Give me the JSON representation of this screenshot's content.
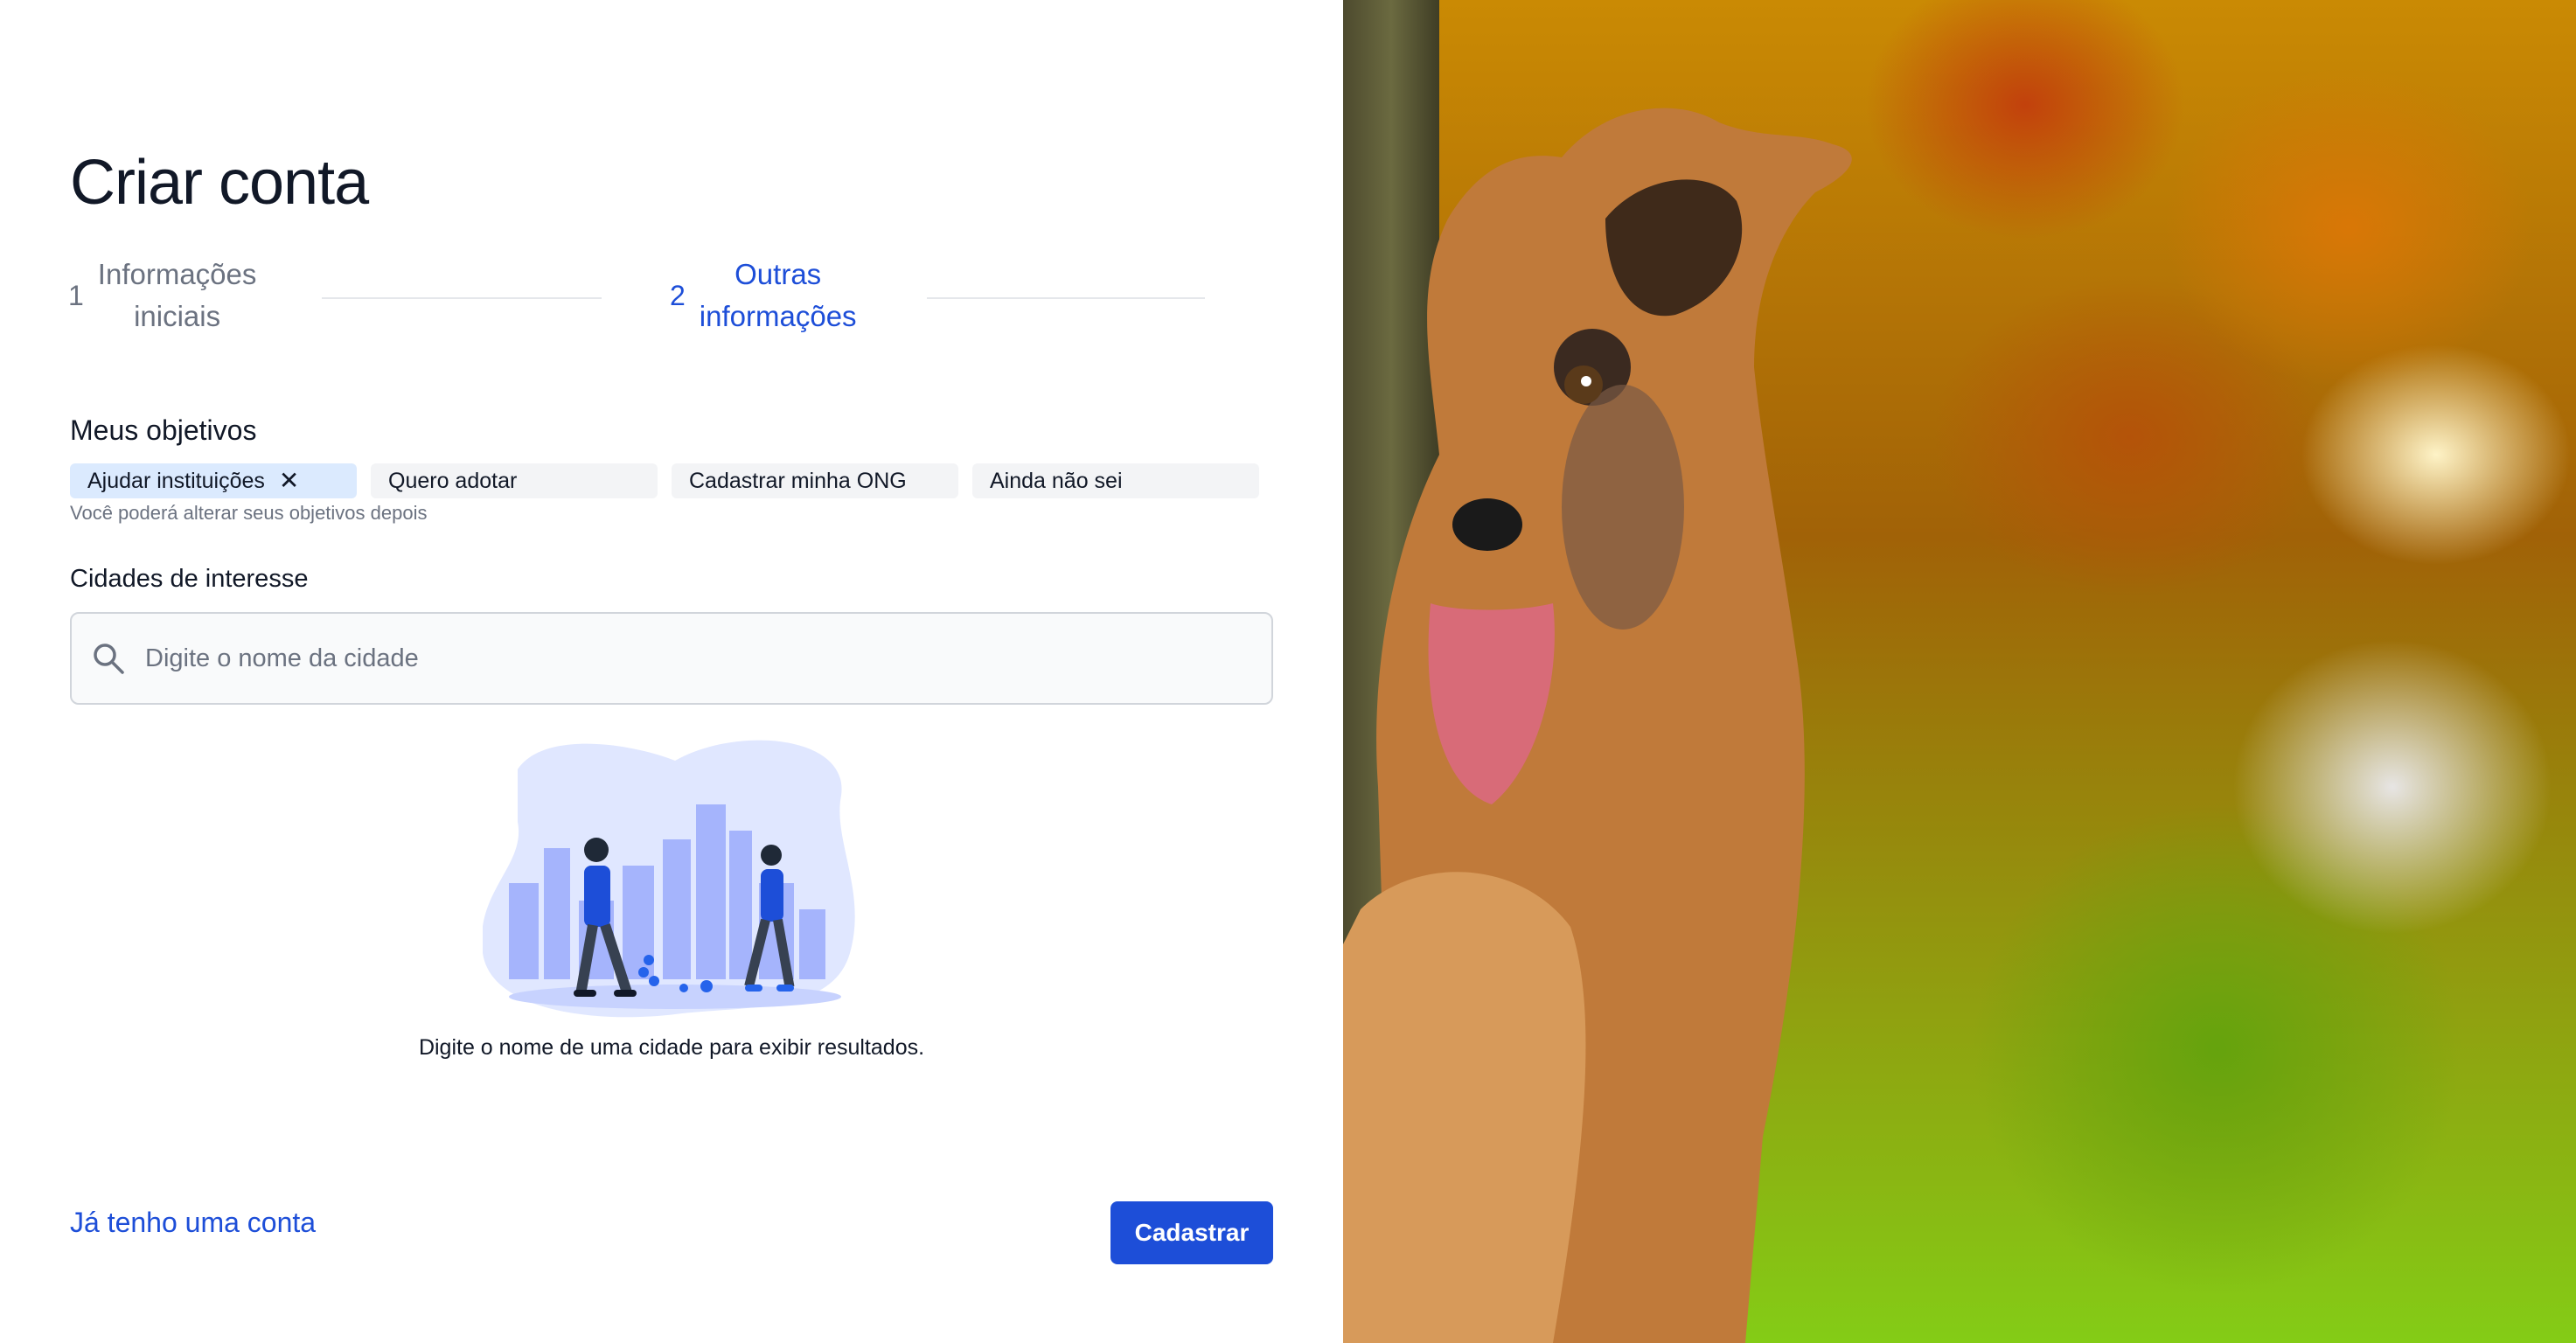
{
  "page": {
    "title": "Criar conta"
  },
  "stepper": {
    "steps": [
      {
        "number": "1",
        "label_line1": "Informações",
        "label_line2": "iniciais",
        "state": "completed"
      },
      {
        "number": "2",
        "label_line1": "Outras",
        "label_line2": "informações",
        "state": "active"
      }
    ],
    "active_color": "#1d4ed8",
    "inactive_color": "#6b7280"
  },
  "goals": {
    "label": "Meus objetivos",
    "options": [
      {
        "label": "Ajudar instituições",
        "selected": true,
        "remove_icon": "close-icon"
      },
      {
        "label": "Quero adotar",
        "selected": false
      },
      {
        "label": "Cadastrar minha ONG",
        "selected": false
      },
      {
        "label": "Ainda não sei",
        "selected": false
      }
    ],
    "helper": "Você poderá alterar seus objetivos depois"
  },
  "cities": {
    "label": "Cidades de interesse",
    "search_icon": "search-icon",
    "placeholder": "Digite o nome da cidade",
    "value": "",
    "empty_state": {
      "illustration": "city-walkers-illustration",
      "message": "Digite o nome de uma cidade para exibir resultados."
    }
  },
  "footer": {
    "login_link": "Já tenho uma conta",
    "submit_label": "Cadastrar"
  },
  "hero": {
    "image": "german-shepherd-dog-photo"
  },
  "colors": {
    "accent": "#1d4ed8",
    "chip_selected_bg": "#dbeafe",
    "chip_bg": "#f3f4f6"
  }
}
